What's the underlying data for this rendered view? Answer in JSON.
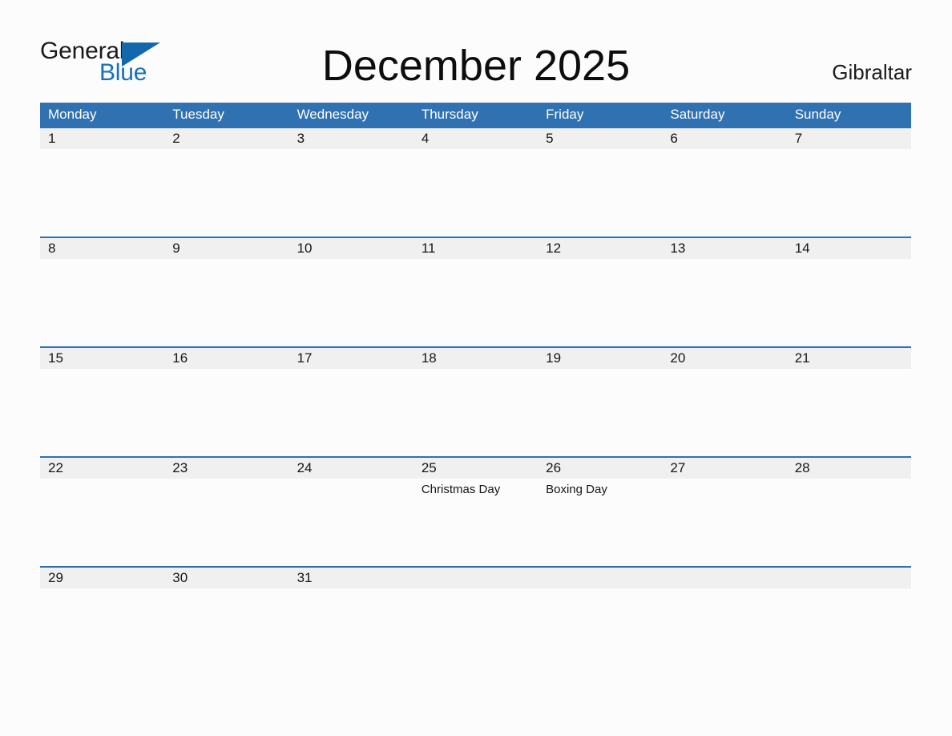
{
  "brand": {
    "name_top": "General",
    "name_bottom": "Blue",
    "triangle_icon": "blue-triangle-icon",
    "colors": {
      "text_dark": "#1a1a1a",
      "blue": "#1670b8",
      "triangle": "#1368ad"
    }
  },
  "header": {
    "title": "December 2025",
    "region": "Gibraltar"
  },
  "theme": {
    "header_blue": "#2f71b1",
    "row_band_grey": "#f0f0f0",
    "page_background": "#fcfcfd",
    "text": "#161616",
    "weekday_text": "#ffffff"
  },
  "calendar": {
    "month": "December",
    "year": "2025",
    "weekdays": [
      "Monday",
      "Tuesday",
      "Wednesday",
      "Thursday",
      "Friday",
      "Saturday",
      "Sunday"
    ],
    "weeks": [
      {
        "days": [
          {
            "date": "1",
            "event": ""
          },
          {
            "date": "2",
            "event": ""
          },
          {
            "date": "3",
            "event": ""
          },
          {
            "date": "4",
            "event": ""
          },
          {
            "date": "5",
            "event": ""
          },
          {
            "date": "6",
            "event": ""
          },
          {
            "date": "7",
            "event": ""
          }
        ]
      },
      {
        "days": [
          {
            "date": "8",
            "event": ""
          },
          {
            "date": "9",
            "event": ""
          },
          {
            "date": "10",
            "event": ""
          },
          {
            "date": "11",
            "event": ""
          },
          {
            "date": "12",
            "event": ""
          },
          {
            "date": "13",
            "event": ""
          },
          {
            "date": "14",
            "event": ""
          }
        ]
      },
      {
        "days": [
          {
            "date": "15",
            "event": ""
          },
          {
            "date": "16",
            "event": ""
          },
          {
            "date": "17",
            "event": ""
          },
          {
            "date": "18",
            "event": ""
          },
          {
            "date": "19",
            "event": ""
          },
          {
            "date": "20",
            "event": ""
          },
          {
            "date": "21",
            "event": ""
          }
        ]
      },
      {
        "days": [
          {
            "date": "22",
            "event": ""
          },
          {
            "date": "23",
            "event": ""
          },
          {
            "date": "24",
            "event": ""
          },
          {
            "date": "25",
            "event": "Christmas Day"
          },
          {
            "date": "26",
            "event": "Boxing Day"
          },
          {
            "date": "27",
            "event": ""
          },
          {
            "date": "28",
            "event": ""
          }
        ]
      },
      {
        "days": [
          {
            "date": "29",
            "event": ""
          },
          {
            "date": "30",
            "event": ""
          },
          {
            "date": "31",
            "event": ""
          },
          {
            "date": "",
            "event": ""
          },
          {
            "date": "",
            "event": ""
          },
          {
            "date": "",
            "event": ""
          },
          {
            "date": "",
            "event": ""
          }
        ]
      }
    ]
  }
}
